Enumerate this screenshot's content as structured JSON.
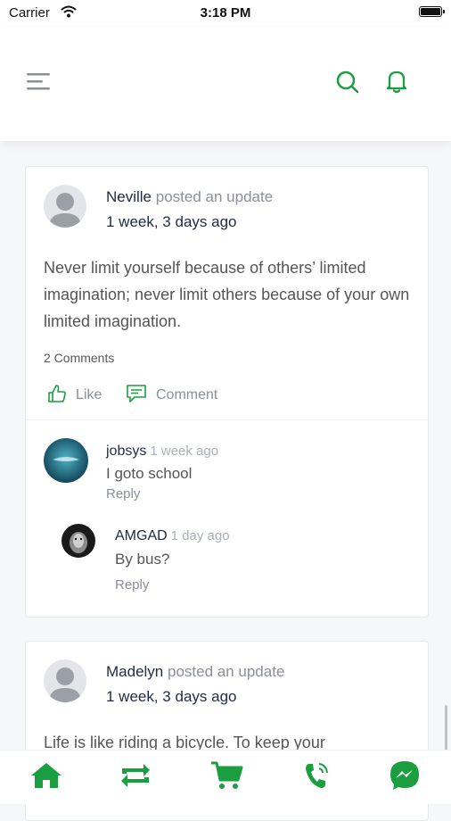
{
  "status_bar": {
    "carrier": "Carrier",
    "time": "3:18 PM"
  },
  "header": {
    "menu_icon": "hamburger-menu-icon",
    "search_icon": "search-icon",
    "notification_icon": "bell-icon",
    "accent_color": "#1a9e3f"
  },
  "posts": [
    {
      "author": "Neville",
      "action": "posted an update",
      "time": "1 week, 3 days ago",
      "text": "Never limit yourself because of others’ limited imagination; never limit others because of your own limited imagination.",
      "comments_count": "2 Comments",
      "like_label": "Like",
      "comment_label": "Comment",
      "comments": [
        {
          "author": "jobsys",
          "time": "1 week ago",
          "text": "I goto school",
          "reply_label": "Reply"
        },
        {
          "author": "AMGAD",
          "time": "1 day ago",
          "text": "By bus?",
          "reply_label": "Reply"
        }
      ]
    },
    {
      "author": "Madelyn",
      "action": "posted an update",
      "time": "1 week, 3 days ago",
      "text": "Life is like riding a bicycle. To keep your"
    }
  ],
  "bottom_nav": {
    "items": [
      "home-icon",
      "activity-refresh-icon",
      "shopping-cart-icon",
      "phone-call-icon",
      "messenger-icon"
    ],
    "color": "#1a9e3f"
  }
}
